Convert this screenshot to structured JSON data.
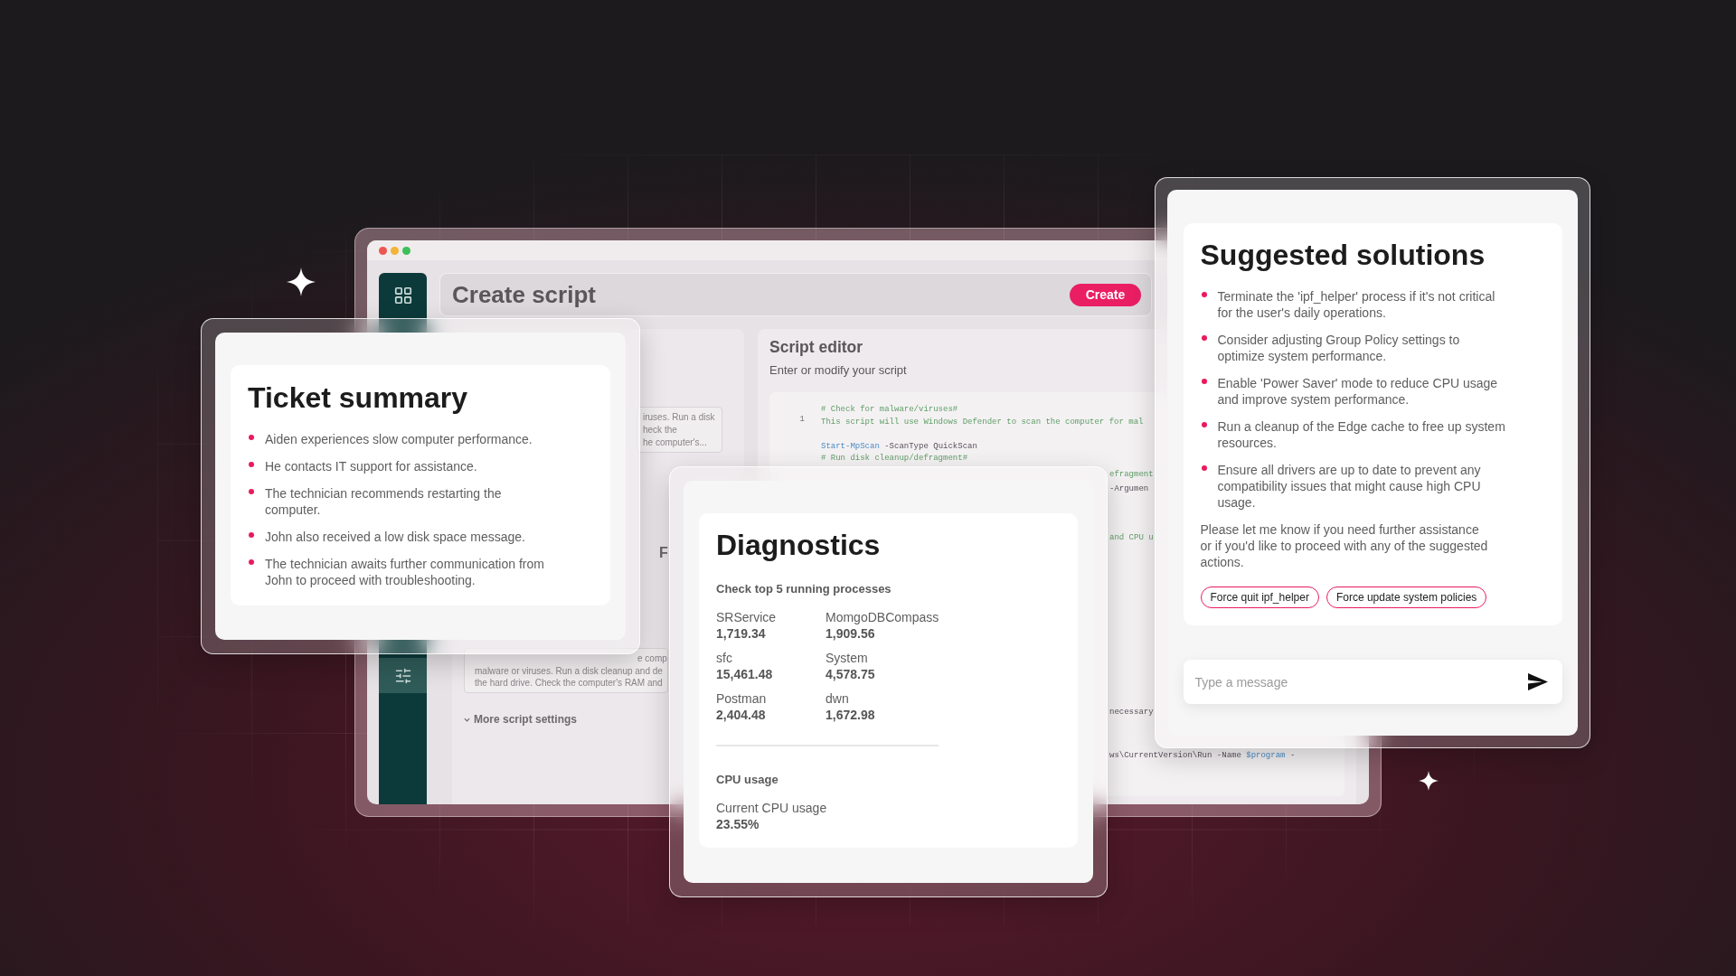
{
  "script_window": {
    "title": "Create script",
    "create_button": "Create",
    "sidebar": {
      "items": [
        {
          "selected": false
        },
        {
          "selected": true
        }
      ]
    },
    "settings_panel": {
      "description_lines": [
        "iruses. Run a disk",
        "heck the",
        "he computer's..."
      ],
      "section_heading": "F",
      "notes_lines": [
        "e comp",
        "malware or viruses. Run a disk cleanup and de",
        "the hard drive. Check the computer's RAM and"
      ],
      "more_settings": "More script settings"
    },
    "script_editor": {
      "title": "Script editor",
      "subtitle": "Enter or modify your script",
      "line_numbers": [
        "1"
      ],
      "lines": [
        {
          "tokens": [
            {
              "kind": "comment",
              "text": "# Check for malware/viruses#"
            }
          ]
        },
        {
          "tokens": [
            {
              "kind": "comment",
              "text": "This script will use Windows Defender to scan the computer for mal"
            }
          ]
        },
        {
          "tokens": [
            {
              "kind": "command",
              "text": "Start-MpScan"
            },
            {
              "kind": "plain",
              "text": "-ScanType QuickScan"
            }
          ]
        },
        {
          "tokens": [
            {
              "kind": "comment",
              "text": "# Run disk cleanup/defragment#"
            }
          ]
        }
      ],
      "cut_lines": [
        {
          "tokens": [
            {
              "kind": "comment",
              "text": "efragment"
            }
          ]
        },
        {
          "tokens": [
            {
              "kind": "plain",
              "text": "-Argumen"
            }
          ]
        },
        {
          "tokens": [
            {
              "kind": "comment",
              "text": "and CPU u"
            }
          ]
        },
        {
          "tokens": [
            {
              "kind": "plain",
              "text": "necessary"
            }
          ]
        },
        {
          "tokens": [
            {
              "kind": "plain",
              "text": "ws\\CurrentVersion\\Run"
            },
            {
              "kind": "plain",
              "text": "-Name"
            },
            {
              "kind": "variable",
              "text": "$program"
            },
            {
              "kind": "plain",
              "text": "-"
            }
          ]
        }
      ]
    }
  },
  "ticket_summary": {
    "title": "Ticket summary",
    "items": [
      "Aiden experiences slow computer performance.",
      "He contacts IT support for assistance.",
      "The technician recommends restarting the computer.",
      "John also received a low disk space message.",
      "The technician awaits further communication from John to proceed with troubleshooting."
    ]
  },
  "diagnostics": {
    "title": "Diagnostics",
    "processes_heading": "Check top 5 running processes",
    "processes": [
      {
        "name": "SRService",
        "value": "1,719.34"
      },
      {
        "name": "MomgoDBCompass",
        "value": "1,909.56"
      },
      {
        "name": "sfc",
        "value": "15,461.48"
      },
      {
        "name": "System",
        "value": "4,578.75"
      },
      {
        "name": "Postman",
        "value": "2,404.48"
      },
      {
        "name": "dwn",
        "value": "1,672.98"
      }
    ],
    "cpu_heading": "CPU usage",
    "cpu_label": "Current CPU usage",
    "cpu_value": "23.55%"
  },
  "suggested_solutions": {
    "title": "Suggested solutions",
    "items": [
      "Terminate the 'ipf_helper' process if it's not critical for the user's daily operations.",
      "Consider adjusting Group Policy settings to optimize system performance.",
      "Enable 'Power Saver' mode to reduce CPU usage and improve system performance.",
      "Run a cleanup of the Edge cache to free up system resources.",
      "Ensure all drivers are up to date to prevent any compatibility issues that might cause high CPU usage."
    ],
    "message": "Please let me know if you need further assistance or if you'd like to proceed with any of the suggested actions.",
    "actions": [
      "Force quit ipf_helper",
      "Force update system policies"
    ],
    "input": {
      "placeholder": "Type a message"
    }
  }
}
